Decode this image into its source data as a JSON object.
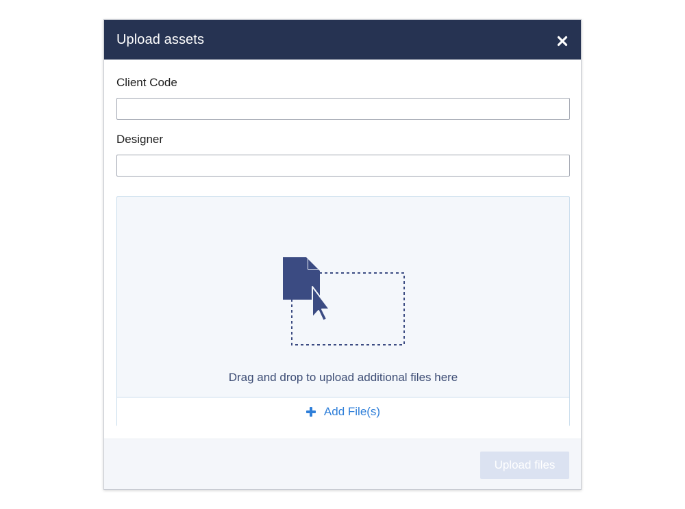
{
  "modal": {
    "title": "Upload assets",
    "close_icon": "close-icon"
  },
  "form": {
    "client_code": {
      "label": "Client Code",
      "value": "",
      "placeholder": ""
    },
    "designer": {
      "label": "Designer",
      "value": "",
      "placeholder": ""
    }
  },
  "dropzone": {
    "illustration_icon": "file-drag-icon",
    "text": "Drag and drop to upload additional files here",
    "add_button_icon": "plus-icon",
    "add_button_label": "Add File(s)"
  },
  "footer": {
    "upload_button_label": "Upload files",
    "upload_button_enabled": false
  },
  "colors": {
    "header_bg": "#263352",
    "accent_blue": "#2f7fd9",
    "icon_navy": "#3b4b82",
    "dropzone_bg": "#f4f7fb",
    "disabled_button": "#dbe2f1"
  }
}
